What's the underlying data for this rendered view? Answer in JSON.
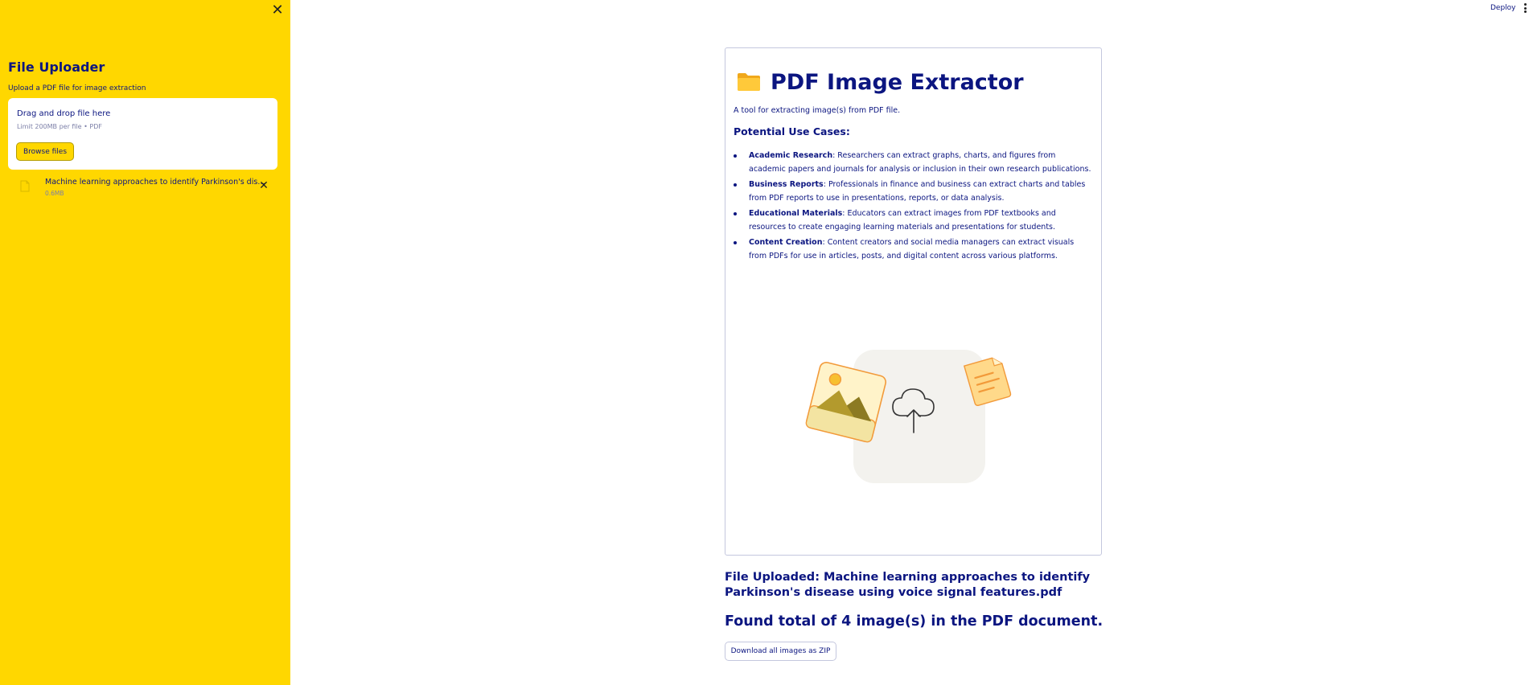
{
  "sidebar": {
    "close_glyph": "✕",
    "title": "File Uploader",
    "subtitle": "Upload a PDF file for image extraction",
    "dropzone": {
      "title": "Drag and drop file here",
      "limit": "Limit 200MB per file • PDF",
      "browse_label": "Browse files"
    },
    "file": {
      "name": "Machine learning approaches to identify Parkinson's disease using voice signal features.pdf",
      "size": "0.6MB",
      "remove_glyph": "✕"
    }
  },
  "topbar": {
    "deploy_label": "Deploy"
  },
  "main": {
    "title": "PDF Image Extractor",
    "description": "A tool for extracting image(s) from PDF file.",
    "use_cases_title": "Potential Use Cases:",
    "use_cases": [
      {
        "term": "Academic Research",
        "text": ": Researchers can extract graphs, charts, and figures from academic papers and journals for analysis or inclusion in their own research publications."
      },
      {
        "term": "Business Reports",
        "text": ": Professionals in finance and business can extract charts and tables from PDF reports to use in presentations, reports, or data analysis."
      },
      {
        "term": "Educational Materials",
        "text": ": Educators can extract images from PDF textbooks and resources to create engaging learning materials and presentations for students."
      },
      {
        "term": "Content Creation",
        "text": ": Content creators and social media managers can extract visuals from PDFs for use in articles, posts, and digital content across various platforms."
      }
    ],
    "uploaded_text": "File Uploaded: Machine learning approaches to identify Parkinson's disease using voice signal features.pdf",
    "found_text": "Found total of 4 image(s) in the PDF document.",
    "download_label": "Download all images as ZIP"
  },
  "colors": {
    "sidebar_bg": "#ffd700",
    "text_primary": "#0b1580",
    "border": "#c4c7de"
  },
  "icons": [
    "close-icon",
    "file-icon",
    "remove-file-icon",
    "kebab-menu-icon",
    "folder-icon",
    "upload-illustration"
  ]
}
